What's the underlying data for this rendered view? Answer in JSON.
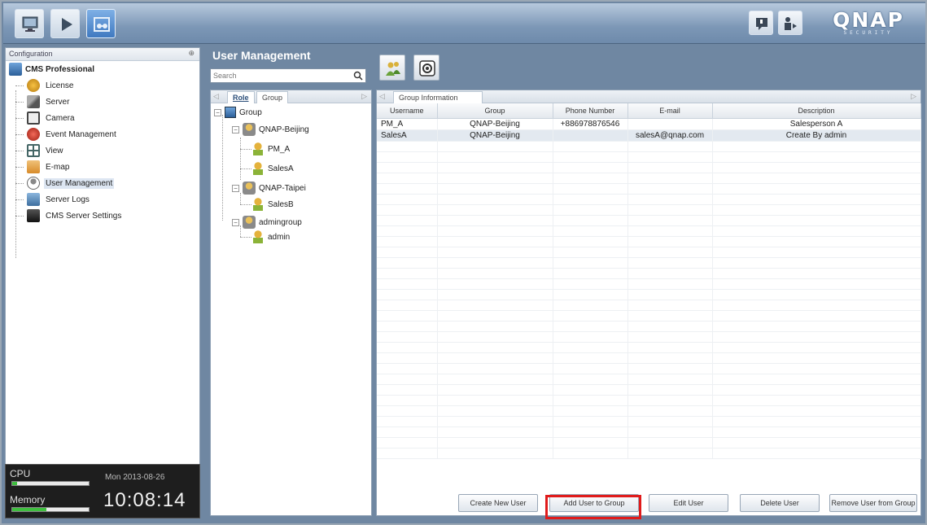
{
  "brand": {
    "logo": "QNAP",
    "logo_sub": "SECURITY"
  },
  "left_panel": {
    "header": "Configuration",
    "pin": "⊕",
    "root": "CMS Professional",
    "items": [
      {
        "label": "License",
        "icon": "license-icon"
      },
      {
        "label": "Server",
        "icon": "server-icon"
      },
      {
        "label": "Camera",
        "icon": "camera-icon"
      },
      {
        "label": "Event Management",
        "icon": "event-icon"
      },
      {
        "label": "View",
        "icon": "view-icon"
      },
      {
        "label": "E-map",
        "icon": "emap-icon"
      },
      {
        "label": "User Management",
        "icon": "user-management-icon",
        "selected": true
      },
      {
        "label": "Server Logs",
        "icon": "server-logs-icon"
      },
      {
        "label": "CMS Server Settings",
        "icon": "server-settings-icon"
      }
    ]
  },
  "status": {
    "cpu_label": "CPU",
    "cpu_usage": 0.06,
    "date": "Mon 2013-08-26",
    "memory_label": "Memory",
    "memory_usage": 0.45,
    "time": "10:08:14"
  },
  "main": {
    "title": "User Management",
    "search_placeholder": "Search"
  },
  "group_panel": {
    "tabs": [
      "Role",
      "Group"
    ],
    "tree": {
      "root": "Group",
      "groups": [
        {
          "name": "QNAP-Beijing",
          "users": [
            "PM_A",
            "SalesA"
          ]
        },
        {
          "name": "QNAP-Taipei",
          "users": [
            "SalesB"
          ]
        },
        {
          "name": "admingroup",
          "users": [
            "admin"
          ]
        }
      ]
    }
  },
  "info_panel": {
    "tab": "Group Information",
    "columns": [
      "Username",
      "Group",
      "Phone Number",
      "E-mail",
      "Description"
    ],
    "rows": [
      [
        "PM_A",
        "QNAP-Beijing",
        "+886978876546",
        "",
        "Salesperson A"
      ],
      [
        "SalesA",
        "QNAP-Beijing",
        "",
        "salesA@qnap.com",
        "Create By admin"
      ]
    ],
    "buttons": [
      "Create New User",
      "Add User to Group",
      "Edit User",
      "Delete User",
      "Remove User from Group"
    ]
  }
}
